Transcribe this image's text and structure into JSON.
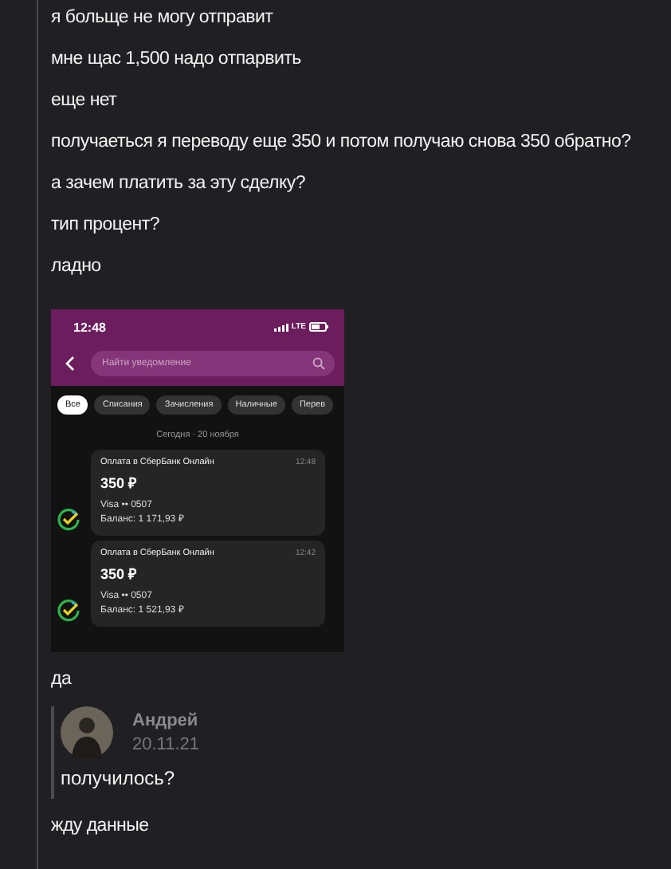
{
  "messages_before": [
    {
      "text": "я больще не могу отправит"
    },
    {
      "text": "мне щас 1,500 надо отпарвить"
    },
    {
      "text": "еще нет"
    },
    {
      "text": "получаеться я переводу еще 350 и потом получаю снова 350 обратно?"
    },
    {
      "text": "а зачем платить за эту сделку?"
    },
    {
      "text": "тип процент?"
    },
    {
      "text": "ладно"
    }
  ],
  "attachment": {
    "status_time": "12:48",
    "network": "LTE",
    "search_placeholder": "Найти уведомление",
    "chips": [
      {
        "label": "Все",
        "selected": true
      },
      {
        "label": "Списания",
        "selected": false
      },
      {
        "label": "Зачисления",
        "selected": false
      },
      {
        "label": "Наличные",
        "selected": false
      },
      {
        "label": "Перев",
        "selected": false
      }
    ],
    "date": "Сегодня · 20 ноября",
    "notifications": [
      {
        "title": "Оплата в СберБанк Онлайн",
        "time": "12:48",
        "amount": "350 ₽",
        "card": "Visa •• 0507",
        "balance": "Баланс: 1 171,93 ₽"
      },
      {
        "title": "Оплата в СберБанк Онлайн",
        "time": "12:42",
        "amount": "350 ₽",
        "card": "Visa •• 0507",
        "balance": "Баланс: 1 521,93 ₽"
      }
    ]
  },
  "message_after": {
    "text": "да"
  },
  "quote": {
    "author": "Андрей",
    "date": "20.11.21",
    "text": "получилось?"
  },
  "message_last": {
    "text": "жду данные"
  }
}
